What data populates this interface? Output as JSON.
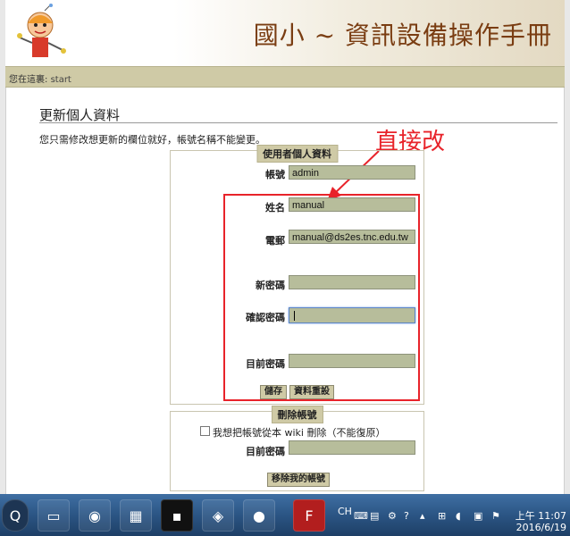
{
  "site": {
    "title": "國小 ~ 資訊設備操作手冊"
  },
  "breadcrumb": {
    "prefix": "您在這裏:",
    "link": "start"
  },
  "page": {
    "title": "更新個人資料",
    "intro": "您只需修改想更新的欄位就好，帳號名稱不能變更。"
  },
  "annotation": {
    "text": "直接改",
    "color": "#e8232a"
  },
  "user_form": {
    "legend": "使用者個人資料",
    "username_label": "帳號",
    "username_value": "admin",
    "name_label": "姓名",
    "name_value": "manual",
    "email_label": "電郵",
    "email_value": "manual@ds2es.tnc.edu.tw",
    "new_password_label": "新密碼",
    "new_password_value": "",
    "confirm_password_label": "確認密碼",
    "confirm_password_value": "",
    "current_password_label": "目前密碼",
    "current_password_value": "",
    "save_label": "儲存",
    "reset_label": "資料重設"
  },
  "delete_form": {
    "legend": "刪除帳號",
    "checkbox_label": "我想把帳號從本 wiki 刪除（不能復原）",
    "current_password_label": "目前密碼",
    "current_password_value": "",
    "remove_label": "移除我的帳號"
  },
  "taskbar": {
    "apps": [
      "qt-icon",
      "window-icon",
      "color-wheel-icon",
      "network-icon",
      "terminal-icon",
      "virtualbox-icon",
      "firefox-icon",
      "filezilla-icon"
    ],
    "tray_lang": "CH",
    "time": "上午 11:07",
    "date": "2016/6/19"
  },
  "colors": {
    "accent_title": "#7a3d12",
    "breadcrumb_bar": "#cfcaa6",
    "input_bg": "#b7bd9b",
    "taskbar": "#2b5584"
  }
}
